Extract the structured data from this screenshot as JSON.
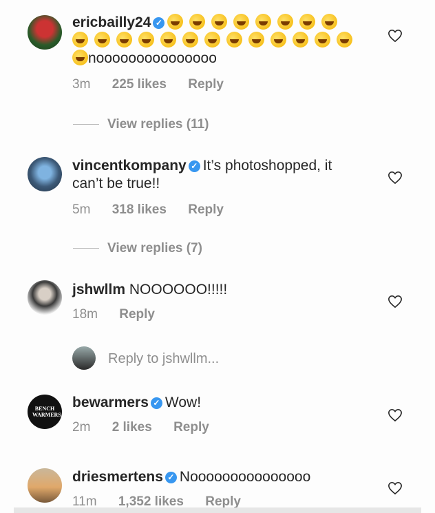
{
  "comments": [
    {
      "username": "ericbailly24",
      "verified": true,
      "text_suffix": "nooooooooooooooo",
      "emoji_count_line1": 8,
      "emoji_count_line2": 13,
      "time": "3m",
      "likes": "225 likes",
      "reply": "Reply",
      "view_replies": "View replies (11)"
    },
    {
      "username": "vincentkompany",
      "verified": true,
      "text": "It’s photoshopped, it can’t be true!!",
      "time": "5m",
      "likes": "318 likes",
      "reply": "Reply",
      "view_replies": "View replies (7)"
    },
    {
      "username": "jshwllm",
      "verified": false,
      "text": "NOOOOOO!!!!!",
      "time": "18m",
      "reply": "Reply",
      "reply_placeholder": "Reply to jshwllm..."
    },
    {
      "username": "bewarmers",
      "verified": true,
      "text": "Wow!",
      "time": "2m",
      "likes": "2 likes",
      "reply": "Reply",
      "avatar_text": "BENCH WARMERS"
    },
    {
      "username": "driesmertens",
      "verified": true,
      "text": "Nooooooooooooooo",
      "time": "11m",
      "likes": "1,352 likes",
      "reply": "Reply"
    }
  ],
  "icons": {
    "like": "heart-outline-icon",
    "verified": "verified-badge-icon",
    "laugh": "rolling-on-floor-laughing-emoji"
  },
  "colors": {
    "verified": "#3897f0",
    "meta": "#8e8e8e",
    "text": "#262626"
  }
}
